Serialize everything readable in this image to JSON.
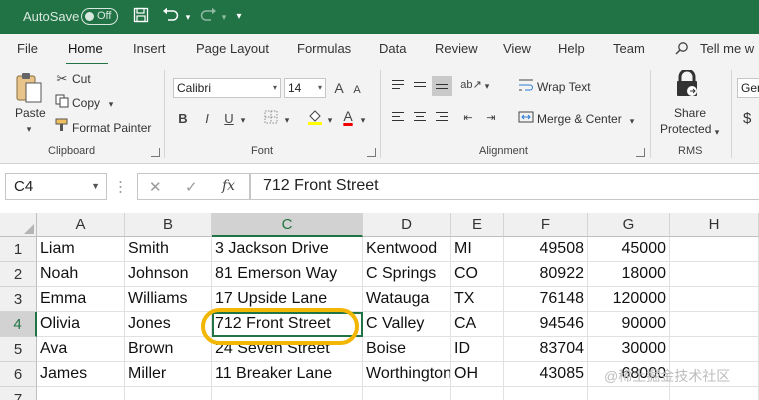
{
  "titlebar": {
    "autosave_label": "AutoSave",
    "autosave_state": "Off"
  },
  "tabs": [
    "File",
    "Home",
    "Insert",
    "Page Layout",
    "Formulas",
    "Data",
    "Review",
    "View",
    "Help",
    "Team"
  ],
  "active_tab": "Home",
  "tell_me": "Tell me w",
  "ribbon": {
    "clipboard": {
      "paste": "Paste",
      "cut": "Cut",
      "copy": "Copy",
      "format_painter": "Format Painter",
      "group": "Clipboard"
    },
    "font": {
      "name": "Calibri",
      "size": "14",
      "group": "Font",
      "bold": "B",
      "italic": "I",
      "underline": "U",
      "grow": "A",
      "shrink": "A",
      "font_color": "A"
    },
    "alignment": {
      "wrap_text": "Wrap Text",
      "merge_center": "Merge & Center",
      "group": "Alignment"
    },
    "rms": {
      "share_line1": "Share",
      "share_line2": "Protected",
      "group": "RMS"
    },
    "number": {
      "format": "Ger",
      "currency": "$"
    }
  },
  "formula_bar": {
    "name_box": "C4",
    "fx": "fx",
    "cancel": "✕",
    "enter": "✓",
    "content": "712 Front Street"
  },
  "sheet": {
    "columns": [
      "A",
      "B",
      "C",
      "D",
      "E",
      "F",
      "G",
      "H"
    ],
    "rows": [
      "1",
      "2",
      "3",
      "4",
      "5",
      "6",
      "7"
    ],
    "data": [
      [
        "Liam",
        "Smith",
        "3 Jackson Drive",
        "Kentwood",
        "MI",
        "49508",
        "45000"
      ],
      [
        "Noah",
        "Johnson",
        "81 Emerson Way",
        "C Springs",
        "CO",
        "80922",
        "18000"
      ],
      [
        "Emma",
        "Williams",
        "17 Upside Lane",
        "Watauga",
        "TX",
        "76148",
        "120000"
      ],
      [
        "Olivia",
        "Jones",
        "712 Front Street",
        "C Valley",
        "CA",
        "94546",
        "90000"
      ],
      [
        "Ava",
        "Brown",
        "24 Seven Street",
        "Boise",
        "ID",
        "83704",
        "30000"
      ],
      [
        "James",
        "Miller",
        "11 Breaker Lane",
        "Worthington",
        "OH",
        "43085",
        "68000"
      ]
    ],
    "active_cell": "C4"
  },
  "watermark": "@稀土掘金技术社区",
  "colors": {
    "excel_green": "#217346",
    "highlight": "#f2b705"
  }
}
